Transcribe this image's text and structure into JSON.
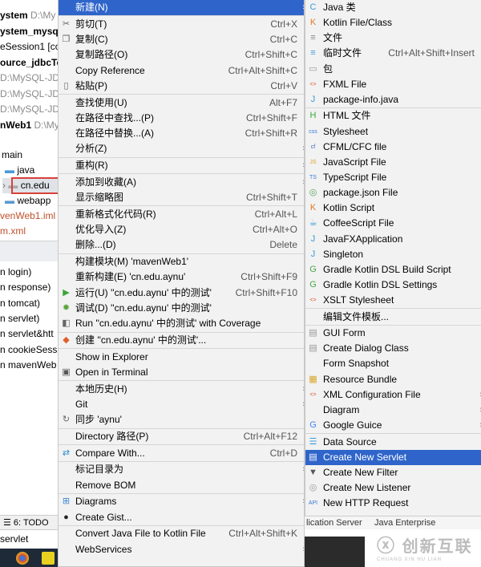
{
  "project_tree": {
    "items": [
      {
        "name": "ystem",
        "path": "D:\\My",
        "bold": true
      },
      {
        "name": "ystem_mysql",
        "path": "",
        "bold": true
      },
      {
        "name": "eSession1 [coo",
        "path": "",
        "bold": false
      },
      {
        "name": "ource_jdbcTe",
        "path": "",
        "bold": true
      },
      {
        "name": "",
        "path": "D:\\MySQL-JD",
        "bold": false
      },
      {
        "name": "",
        "path": "D:\\MySQL-JDI",
        "bold": false
      },
      {
        "name": "",
        "path": "D:\\MySQL-JDE",
        "bold": false
      },
      {
        "name": "nWeb1",
        "path": "D:\\My",
        "bold": true
      }
    ],
    "main": "main",
    "java": "java",
    "selected_package": "cn.edu",
    "webapp": "webapp",
    "iml": "venWeb1.iml",
    "pom": "m.xml",
    "run_configs": [
      "n login)",
      "n response)",
      "n tomcat)",
      "n servlet)",
      "n servlet&htt",
      "n cookieSessi",
      "n mavenWeb"
    ],
    "todo_tab": "6: TODO",
    "bottom_label": "servlet"
  },
  "context_menu": [
    {
      "label": "新建(N)",
      "arrow": true,
      "selected": true
    },
    {
      "sep": true
    },
    {
      "label": "剪切(T)",
      "shortcut": "Ctrl+X",
      "icon": "scissors-icon",
      "glyph": "✂"
    },
    {
      "label": "复制(C)",
      "shortcut": "Ctrl+C",
      "icon": "copy-icon",
      "glyph": "❐"
    },
    {
      "label": "复制路径(O)",
      "shortcut": "Ctrl+Shift+C"
    },
    {
      "label": "Copy Reference",
      "shortcut": "Ctrl+Alt+Shift+C"
    },
    {
      "label": "粘贴(P)",
      "shortcut": "Ctrl+V",
      "icon": "paste-icon",
      "glyph": "▯"
    },
    {
      "sep": true
    },
    {
      "label": "查找使用(U)",
      "shortcut": "Alt+F7"
    },
    {
      "label": "在路径中查找...(P)",
      "shortcut": "Ctrl+Shift+F"
    },
    {
      "label": "在路径中替换...(A)",
      "shortcut": "Ctrl+Shift+R"
    },
    {
      "label": "分析(Z)",
      "arrow": true
    },
    {
      "sep": true
    },
    {
      "label": "重构(R)",
      "arrow": true
    },
    {
      "sep": true
    },
    {
      "label": "添加到收藏(A)",
      "arrow": true
    },
    {
      "label": "显示缩略图",
      "shortcut": "Ctrl+Shift+T"
    },
    {
      "sep": true
    },
    {
      "label": "重新格式化代码(R)",
      "shortcut": "Ctrl+Alt+L"
    },
    {
      "label": "优化导入(Z)",
      "shortcut": "Ctrl+Alt+O"
    },
    {
      "label": "删除...(D)",
      "shortcut": "Delete"
    },
    {
      "sep": true
    },
    {
      "label": "构建模块(M) 'mavenWeb1'"
    },
    {
      "label": "重新构建(E) 'cn.edu.aynu'",
      "shortcut": "Ctrl+Shift+F9"
    },
    {
      "label": "运行(U) ''cn.edu.aynu' 中的测试'",
      "shortcut": "Ctrl+Shift+F10",
      "icon": "run-icon",
      "glyph": "▶",
      "color": "#3aa53a"
    },
    {
      "label": "调试(D) ''cn.edu.aynu' 中的测试'",
      "icon": "debug-icon",
      "glyph": "✹",
      "color": "#5aa53a"
    },
    {
      "label": "Run ''cn.edu.aynu' 中的测试' with Coverage",
      "icon": "coverage-icon",
      "glyph": "◧",
      "color": "#666"
    },
    {
      "sep": true
    },
    {
      "label": "创建 ''cn.edu.aynu' 中的测试'...",
      "icon": "create-test-icon",
      "glyph": "◆",
      "color": "#e0602a"
    },
    {
      "sep": true
    },
    {
      "label": "Show in Explorer"
    },
    {
      "label": "Open in Terminal",
      "icon": "terminal-icon",
      "glyph": "▣",
      "color": "#555"
    },
    {
      "sep": true
    },
    {
      "label": "本地历史(H)",
      "arrow": true
    },
    {
      "label": "Git",
      "arrow": true
    },
    {
      "label": "同步 'aynu'",
      "icon": "sync-icon",
      "glyph": "↻",
      "color": "#666"
    },
    {
      "sep": true
    },
    {
      "label": "Directory 路径(P)",
      "shortcut": "Ctrl+Alt+F12"
    },
    {
      "sep": true
    },
    {
      "label": "Compare With...",
      "shortcut": "Ctrl+D",
      "icon": "compare-icon",
      "glyph": "⇄",
      "color": "#2a8ad0"
    },
    {
      "sep": true
    },
    {
      "label": "标记目录为",
      "arrow": true
    },
    {
      "label": "Remove BOM"
    },
    {
      "sep": true
    },
    {
      "label": "Diagrams",
      "arrow": true,
      "icon": "diagrams-icon",
      "glyph": "⊞",
      "color": "#3a8ad0"
    },
    {
      "label": "Create Gist...",
      "icon": "github-icon",
      "glyph": "●",
      "color": "#222"
    },
    {
      "sep": true
    },
    {
      "label": "Convert Java File to Kotlin File",
      "shortcut": "Ctrl+Alt+Shift+K"
    },
    {
      "label": "WebServices",
      "arrow": true
    }
  ],
  "new_submenu": [
    {
      "label": "Java 类",
      "icon": "java-class-icon",
      "glyph": "C",
      "color": "#3a9ad9"
    },
    {
      "label": "Kotlin File/Class",
      "icon": "kotlin-icon",
      "glyph": "K",
      "color": "#e07a2a"
    },
    {
      "label": "文件",
      "icon": "file-icon",
      "glyph": "≡",
      "color": "#888"
    },
    {
      "label": "临时文件",
      "shortcut": "Ctrl+Alt+Shift+Insert",
      "icon": "scratch-file-icon",
      "glyph": "≡",
      "color": "#3a9ad9"
    },
    {
      "label": "包",
      "icon": "package-icon",
      "glyph": "▭",
      "color": "#999"
    },
    {
      "label": "FXML File",
      "icon": "fxml-icon",
      "glyph": "<>",
      "color": "#d9502a"
    },
    {
      "label": "package-info.java",
      "icon": "package-info-icon",
      "glyph": "J",
      "color": "#3a9ad9"
    },
    {
      "sep": true
    },
    {
      "label": "HTML 文件",
      "icon": "html-icon",
      "glyph": "H",
      "color": "#3aa53a"
    },
    {
      "label": "Stylesheet",
      "icon": "css-icon",
      "glyph": "css",
      "color": "#3a7ad9"
    },
    {
      "label": "CFML/CFC file",
      "icon": "cfml-icon",
      "glyph": "cf",
      "color": "#3a6ab9"
    },
    {
      "label": "JavaScript File",
      "icon": "js-icon",
      "glyph": "JS",
      "color": "#d9a52a"
    },
    {
      "label": "TypeScript File",
      "icon": "ts-icon",
      "glyph": "TS",
      "color": "#3a7ad9"
    },
    {
      "label": "package.json File",
      "icon": "package-json-icon",
      "glyph": "◎",
      "color": "#5aa55a"
    },
    {
      "label": "Kotlin Script",
      "icon": "kotlin-script-icon",
      "glyph": "K",
      "color": "#e07a2a"
    },
    {
      "label": "CoffeeScript File",
      "icon": "coffeescript-icon",
      "glyph": "☕",
      "color": "#3a9ad9"
    },
    {
      "label": "JavaFXApplication",
      "icon": "javafx-icon",
      "glyph": "J",
      "color": "#3a9ad9"
    },
    {
      "label": "Singleton",
      "icon": "singleton-icon",
      "glyph": "J",
      "color": "#3a9ad9"
    },
    {
      "label": "Gradle Kotlin DSL Build Script",
      "icon": "gradle-icon",
      "glyph": "G",
      "color": "#4aa54a"
    },
    {
      "label": "Gradle Kotlin DSL Settings",
      "icon": "gradle-icon",
      "glyph": "G",
      "color": "#4aa54a"
    },
    {
      "label": "XSLT Stylesheet",
      "icon": "xslt-icon",
      "glyph": "<>",
      "color": "#d9502a"
    },
    {
      "sep": true
    },
    {
      "label": "编辑文件模板..."
    },
    {
      "sep": true
    },
    {
      "label": "GUI Form",
      "icon": "gui-form-icon",
      "glyph": "▤",
      "color": "#999"
    },
    {
      "label": "Create Dialog Class",
      "icon": "dialog-class-icon",
      "glyph": "▤",
      "color": "#999"
    },
    {
      "label": "Form Snapshot"
    },
    {
      "label": "Resource Bundle",
      "icon": "resource-bundle-icon",
      "glyph": "▦",
      "color": "#d9a52a"
    },
    {
      "label": "XML Configuration File",
      "arrow": true,
      "icon": "xml-icon",
      "glyph": "<>",
      "color": "#d9502a"
    },
    {
      "label": "Diagram",
      "arrow": true
    },
    {
      "label": "Google Guice",
      "arrow": true,
      "icon": "google-icon",
      "glyph": "G",
      "color": "#4285f4"
    },
    {
      "sep": true
    },
    {
      "label": "Data Source",
      "icon": "database-icon",
      "glyph": "☰",
      "color": "#3a9ad9"
    },
    {
      "label": "Create New Servlet",
      "selected": true,
      "icon": "servlet-icon",
      "glyph": "▤",
      "color": "#9ab"
    },
    {
      "label": "Create New Filter",
      "icon": "filter-icon",
      "glyph": "▼",
      "color": "#555"
    },
    {
      "label": "Create New Listener",
      "icon": "listener-icon",
      "glyph": "◎",
      "color": "#999"
    },
    {
      "label": "New HTTP Request",
      "icon": "http-request-icon",
      "glyph": "API",
      "color": "#3a7ad9"
    }
  ],
  "bottom_tabs": {
    "app_servers": "lication Server",
    "java_enterprise": "Java Enterprise"
  },
  "watermark": {
    "text": "创新互联",
    "sub": "CHUANG XIN HU LIAN"
  }
}
